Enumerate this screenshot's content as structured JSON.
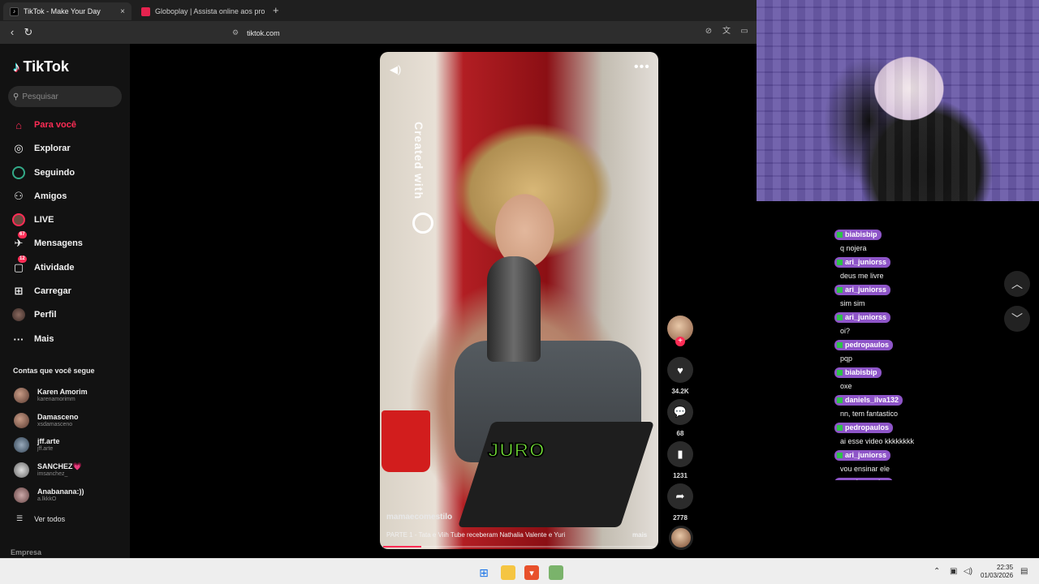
{
  "browser": {
    "tabs": [
      {
        "title": "TikTok - Make Your Day",
        "active": true
      },
      {
        "title": "Globoplay | Assista online aos progra...",
        "active": false
      }
    ],
    "new_tab": "+",
    "close_tab": "×",
    "url": "tiktok.com"
  },
  "sidebar": {
    "logo": "TikTok",
    "search_placeholder": "Pesquisar",
    "nav": [
      {
        "label": "Para você",
        "icon": "home-icon",
        "active": true
      },
      {
        "label": "Explorar",
        "icon": "compass-icon"
      },
      {
        "label": "Seguindo",
        "icon": "following-icon"
      },
      {
        "label": "Amigos",
        "icon": "friends-icon"
      },
      {
        "label": "LIVE",
        "icon": "live-icon"
      },
      {
        "label": "Mensagens",
        "icon": "messages-icon",
        "badge": "67"
      },
      {
        "label": "Atividade",
        "icon": "activity-icon",
        "badge": "12"
      },
      {
        "label": "Carregar",
        "icon": "upload-icon"
      },
      {
        "label": "Perfil",
        "icon": "profile-icon"
      },
      {
        "label": "Mais",
        "icon": "more-icon"
      }
    ],
    "following_title": "Contas que você segue",
    "accounts": [
      {
        "name": "Karen Amorim",
        "handle": "karenamorimm"
      },
      {
        "name": "Damasceno",
        "handle": "xsdamasceno"
      },
      {
        "name": "jff.arte",
        "handle": "jff.arte"
      },
      {
        "name": "SANCHEZ💗",
        "handle": "imsanchez_"
      },
      {
        "name": "Anabanana:))",
        "handle": "a.lkkkO"
      }
    ],
    "see_all": "Ver todos",
    "footer": "Empresa"
  },
  "video": {
    "watermark": "Created with",
    "caption_overlay": "JURO",
    "author": "mamaecomestilo",
    "description": "PARTE 1 - Tata e Viih Tube receberam Nathalia Valente e Yuri",
    "more": "mais",
    "progress": 0.14,
    "likes": "34.2K",
    "comments": "68",
    "saves": "1231",
    "shares": "2778"
  },
  "chat": [
    {
      "user": "biabisbip",
      "text": "q nojera"
    },
    {
      "user": "ari_juniorss",
      "text": "deus me livre"
    },
    {
      "user": "ari_juniorss",
      "text": "sim sim"
    },
    {
      "user": "ari_juniorss",
      "text": "oi?"
    },
    {
      "user": "pedropaulos",
      "text": "pqp"
    },
    {
      "user": "biabisbip",
      "text": "oxe"
    },
    {
      "user": "daniels_ilva132",
      "text": "nn, tem fantastico"
    },
    {
      "user": "pedropaulos",
      "text": "ai esse video kkkkkkkk"
    },
    {
      "user": "ari_juniorss",
      "text": "vou ensinar ele"
    },
    {
      "user": "pedropaulos",
      "text": ""
    }
  ],
  "taskbar": {
    "time": "22:35",
    "date": "01/03/2026"
  },
  "colors": {
    "accent": "#fe2c55",
    "chat_badge": "#8e55c8",
    "caption": "#7cf43a"
  }
}
